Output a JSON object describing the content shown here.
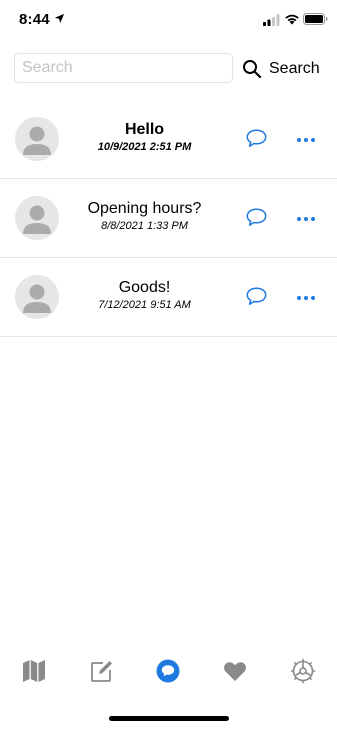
{
  "status_bar": {
    "time": "8:44",
    "icons": [
      "location-arrow-icon",
      "cellular-signal-icon",
      "wifi-icon",
      "battery-icon"
    ]
  },
  "search": {
    "value": "",
    "placeholder": "Search",
    "button_label": "Search",
    "button_icon": "search-icon"
  },
  "conversations": [
    {
      "title": "Hello",
      "date": "10/9/2021 2:51 PM",
      "unread": true
    },
    {
      "title": "Opening hours?",
      "date": "8/8/2021 1:33 PM",
      "unread": false
    },
    {
      "title": "Goods!",
      "date": "7/12/2021 9:51 AM",
      "unread": false
    }
  ],
  "row_actions": {
    "reply_icon": "chat-bubble-icon",
    "more_icon": "more-dots-icon"
  },
  "tab_bar": {
    "tabs": [
      {
        "icon": "map-icon",
        "active": false
      },
      {
        "icon": "compose-icon",
        "active": false
      },
      {
        "icon": "messages-icon",
        "active": true
      },
      {
        "icon": "heart-icon",
        "active": false
      },
      {
        "icon": "settings-gear-icon",
        "active": false
      }
    ]
  },
  "colors": {
    "accent": "#1f7ae0",
    "inactive_icon": "#8a8a8a",
    "divider": "#e6e6e6",
    "placeholder": "#c4c4c4"
  }
}
